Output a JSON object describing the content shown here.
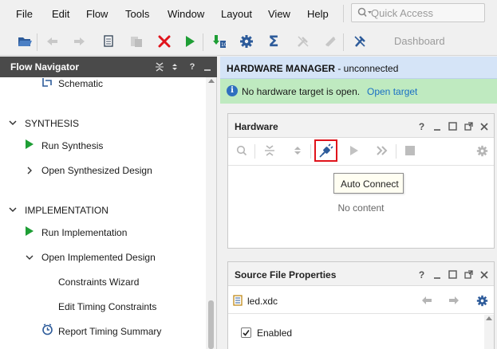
{
  "menu": {
    "items": [
      "File",
      "Edit",
      "Flow",
      "Tools",
      "Window",
      "Layout",
      "View",
      "Help"
    ],
    "quick_access_placeholder": "Quick Access"
  },
  "toolbar": {
    "dashboard_label": "Dashboard",
    "icons": [
      "open-project-icon",
      "undo-icon",
      "redo-icon",
      "copy-icon",
      "paste-icon",
      "delete-icon",
      "run-icon",
      "program-icon",
      "settings-icon",
      "sigma-icon",
      "disabled-tool-icon",
      "disabled-tool-icon-2",
      "cancel-tool-icon"
    ]
  },
  "flow_navigator": {
    "title": "Flow Navigator",
    "items": {
      "schematic": "Schematic",
      "synthesis_section": "SYNTHESIS",
      "run_synthesis": "Run Synthesis",
      "open_synth_design": "Open Synthesized Design",
      "implementation_section": "IMPLEMENTATION",
      "run_implementation": "Run Implementation",
      "open_impl_design": "Open Implemented Design",
      "constraints_wizard": "Constraints Wizard",
      "edit_timing_constraints": "Edit Timing Constraints",
      "report_timing_summary": "Report Timing Summary"
    }
  },
  "hardware_manager": {
    "header_title": "HARDWARE MANAGER",
    "header_status": " - unconnected",
    "banner_message": "No hardware target is open.",
    "banner_link": "Open target"
  },
  "hardware_panel": {
    "title": "Hardware",
    "empty_text": "No content",
    "tooltip": "Auto Connect"
  },
  "source_file_panel": {
    "title": "Source File Properties",
    "file_name": "led.xdc",
    "enabled_label": "Enabled",
    "enabled_checked": true
  },
  "colors": {
    "accent_blue": "#1a6fc4",
    "run_green": "#1e9e35",
    "delete_red": "#e0131b",
    "highlight_red": "#e0131b",
    "banner_green": "#bfeac0",
    "header_blue": "#d5e4f7"
  }
}
